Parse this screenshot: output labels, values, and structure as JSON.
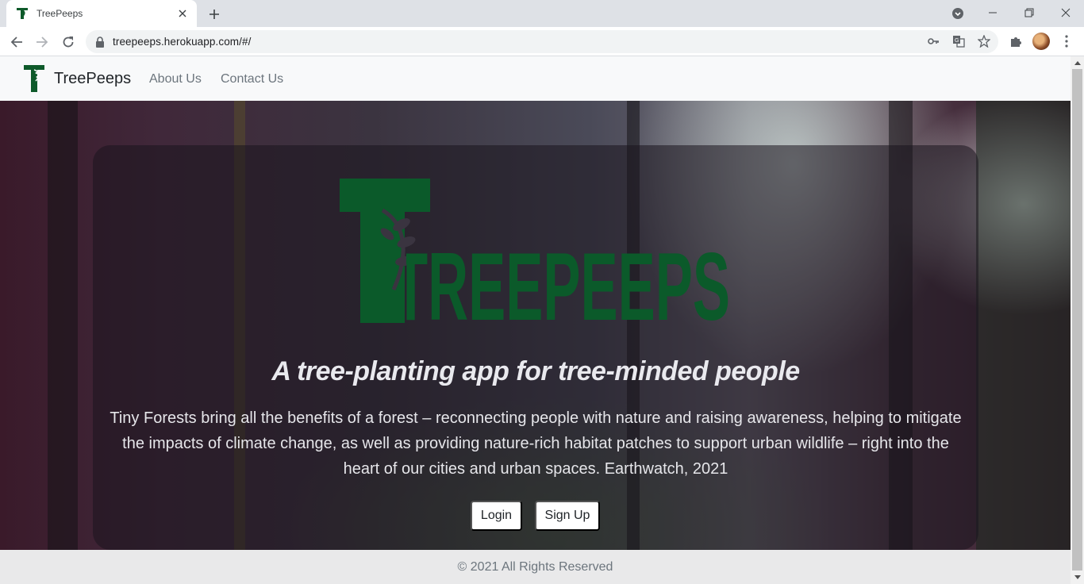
{
  "browser": {
    "tab_title": "TreePeeps",
    "url": "treepeeps.herokuapp.com/#/"
  },
  "site": {
    "brand_name": "TreePeeps",
    "nav_links": [
      "About Us",
      "Contact Us"
    ],
    "logo_text": "TREEPEEPS",
    "tagline": "A tree-planting app for tree-minded people",
    "quote": "Tiny Forests bring all the benefits of a forest – reconnecting people with nature and raising awareness, helping to mitigate the impacts of climate change, as well as providing nature-rich habitat patches to support urban wildlife – right into the heart of our cities and urban spaces. Earthwatch, 2021",
    "buttons": {
      "login": "Login",
      "signup": "Sign Up"
    },
    "footer": "© 2021 All Rights Reserved"
  },
  "colors": {
    "brand_green": "#0e5a2a",
    "nav_bg": "#f8f9fa",
    "footer_bg": "#e9e9ea"
  }
}
